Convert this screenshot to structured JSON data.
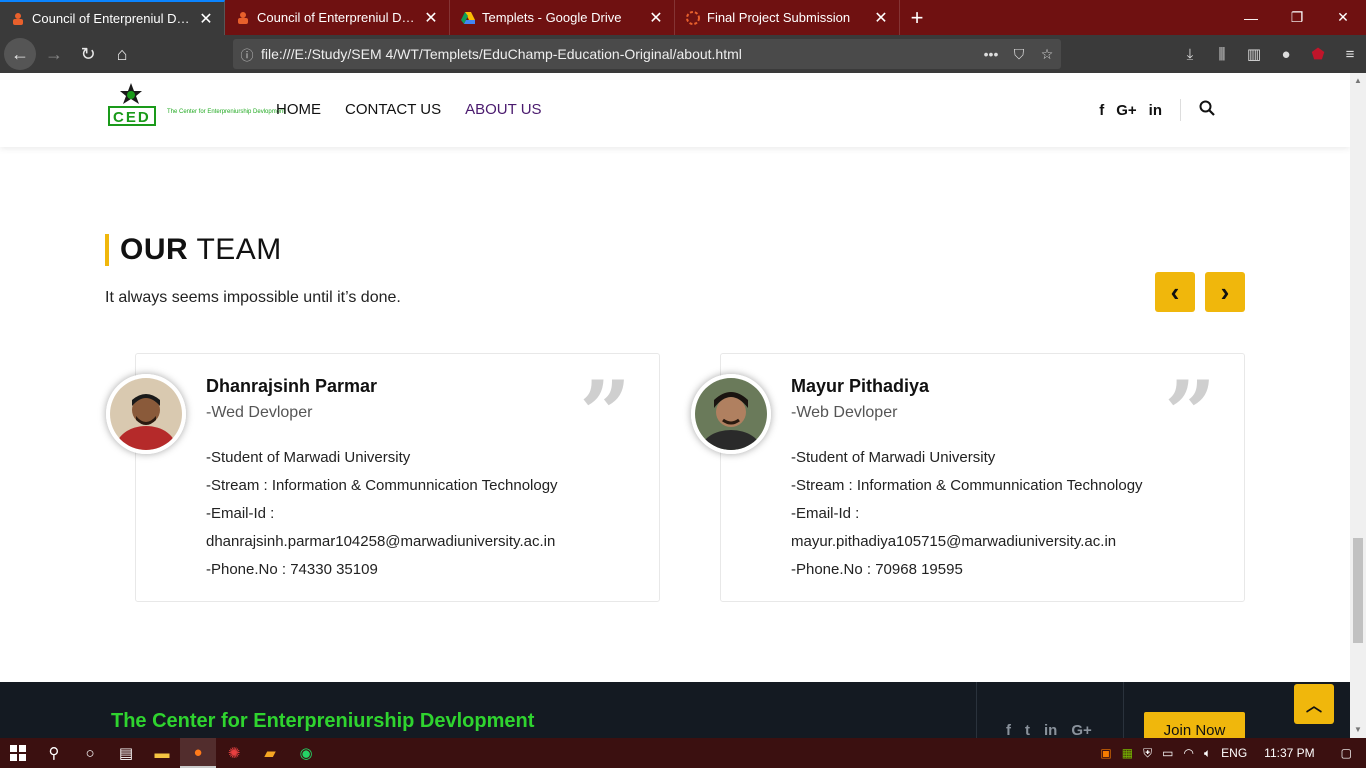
{
  "browser": {
    "tabs": [
      {
        "title": "Council of Enterpreniul Devlopm",
        "active": true
      },
      {
        "title": "Council of Enterpreniul Devlopm",
        "active": false
      },
      {
        "title": "Templets - Google Drive",
        "active": false
      },
      {
        "title": "Final Project Submission",
        "active": false
      }
    ],
    "url": "file:///E:/Study/SEM 4/WT/Templets/EduChamp-Education-Original/about.html",
    "icons": [
      "back-icon",
      "forward-icon",
      "reload-icon",
      "home-icon",
      "more-icon",
      "pocket-icon",
      "star-icon",
      "download-icon",
      "library-icon",
      "sidebar-icon",
      "account-icon",
      "ublock-icon",
      "menu-icon"
    ]
  },
  "site": {
    "logo_text": "CED",
    "logo_tagline": "The Center for Enterpreniurship Devlopment",
    "nav": [
      "HOME",
      "CONTACT US",
      "ABOUT US"
    ],
    "nav_active": "ABOUT US",
    "social_icons": [
      "facebook-icon",
      "google-plus-icon",
      "linkedin-icon"
    ],
    "social_glyphs": {
      "fb": "f",
      "gp": "G+",
      "li": "in"
    }
  },
  "team": {
    "title_bold": "OUR",
    "title_rest": " TEAM",
    "subtitle": "It always seems impossible until it’s done.",
    "prev_label": "‹",
    "next_label": "›",
    "members": [
      {
        "name": "Dhanrajsinh Parmar",
        "role": "-Wed Devloper",
        "lines": [
          "-Student of Marwadi University",
          "-Stream : Information & Communnication Technology",
          "-Email-Id :",
          "dhanrajsinh.parmar104258@marwadiuniversity.ac.in",
          "-Phone.No : 74330 35109"
        ]
      },
      {
        "name": "Mayur Pithadiya",
        "role": "-Web Devloper",
        "lines": [
          "-Student of Marwadi University",
          "-Stream : Information & Communnication Technology",
          "-Email-Id :",
          "mayur.pithadiya105715@marwadiuniversity.ac.in",
          "-Phone.No : 70968 19595"
        ]
      }
    ]
  },
  "footer": {
    "brand": "The Center for Enterpreniurship Devlopment",
    "join_label": "Join Now",
    "social_glyphs": {
      "fb": "f",
      "tw": "t",
      "li": "in",
      "gp": "G+"
    }
  },
  "taskbar": {
    "lang": "ENG",
    "time": "11:37 PM"
  },
  "colors": {
    "accent": "#f0b70c",
    "tabbar": "#6f1111",
    "footer": "#141a22",
    "brand_green": "#2fd42f"
  }
}
